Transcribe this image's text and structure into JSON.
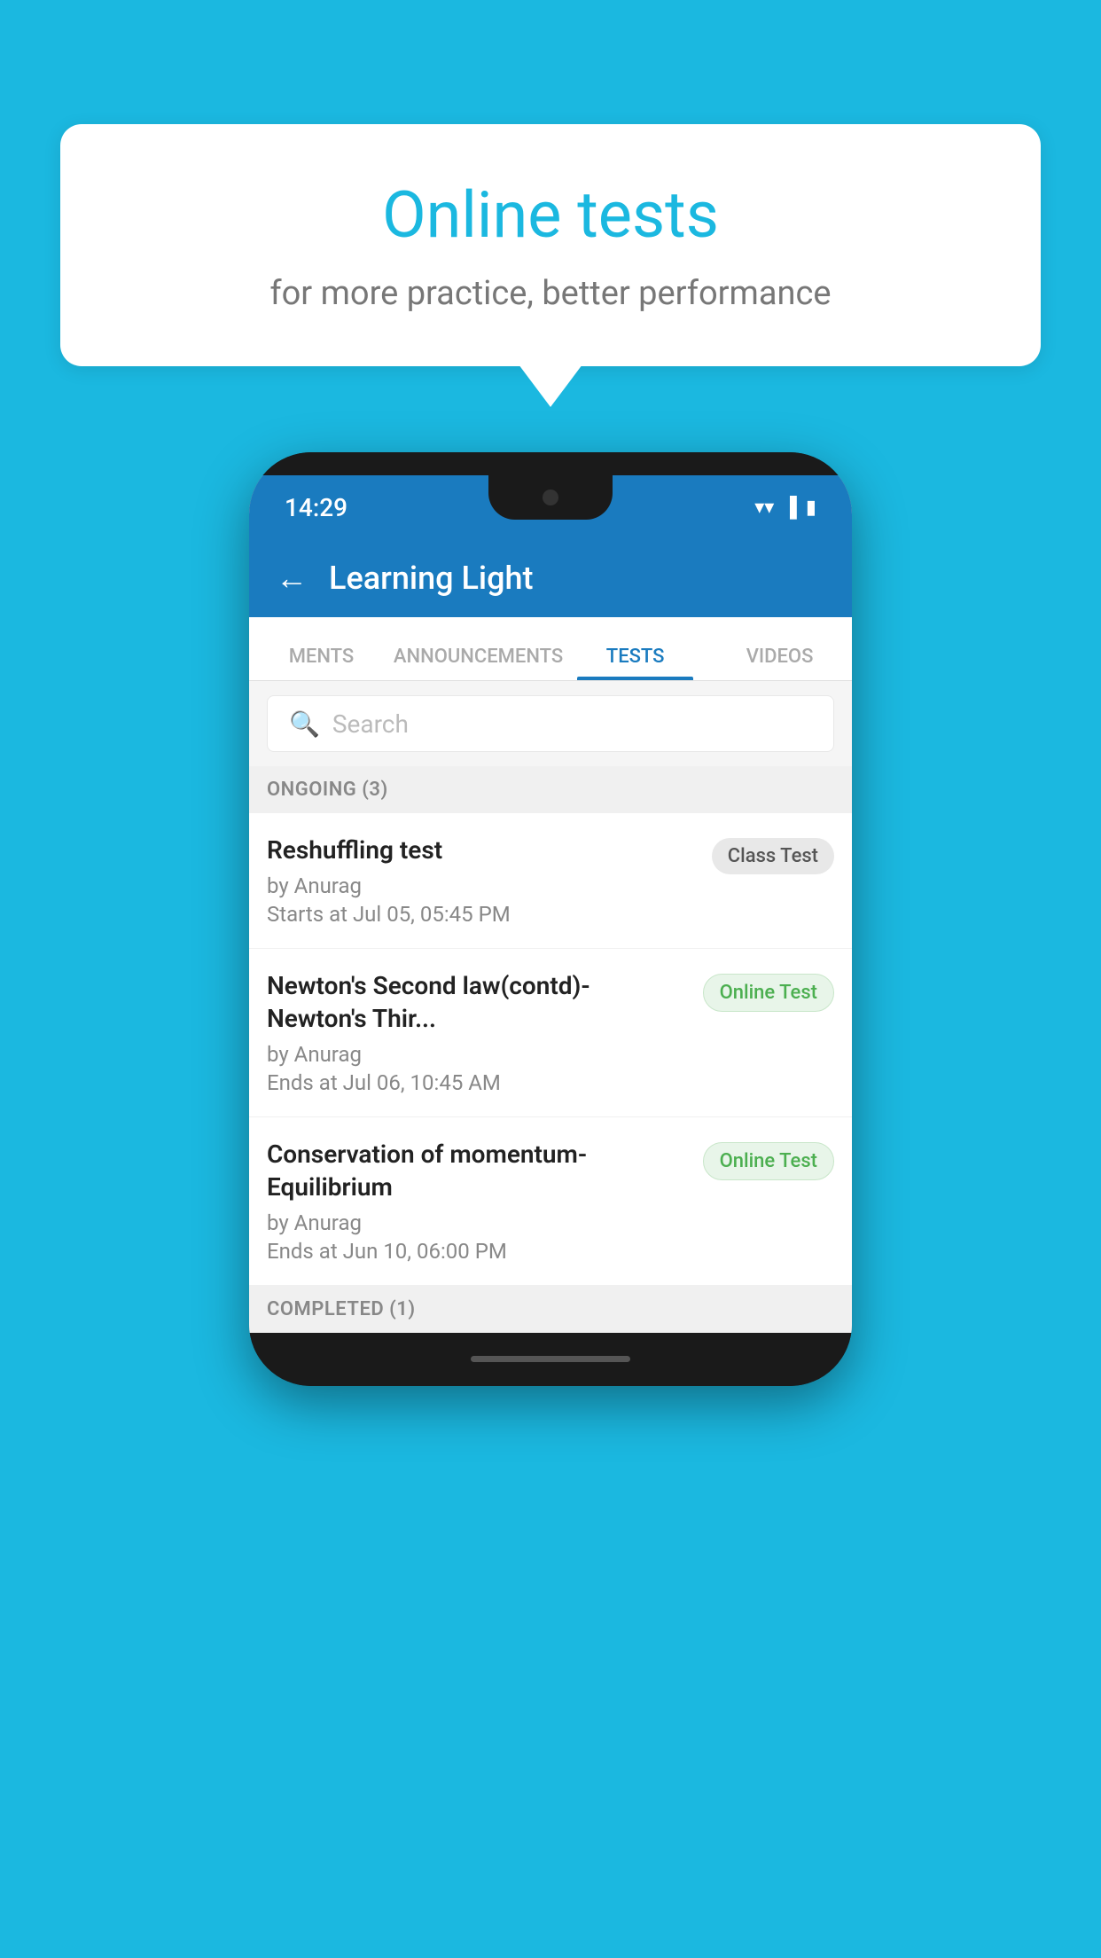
{
  "background_color": "#1bb8e0",
  "speech_bubble": {
    "title": "Online tests",
    "subtitle": "for more practice, better performance"
  },
  "phone": {
    "status_bar": {
      "time": "14:29",
      "icons": [
        "wifi",
        "signal",
        "battery"
      ]
    },
    "app_header": {
      "back_label": "←",
      "title": "Learning Light"
    },
    "tabs": [
      {
        "label": "MENTS",
        "active": false
      },
      {
        "label": "ANNOUNCEMENTS",
        "active": false
      },
      {
        "label": "TESTS",
        "active": true
      },
      {
        "label": "VIDEOS",
        "active": false
      }
    ],
    "search": {
      "placeholder": "Search"
    },
    "ongoing_section": {
      "label": "ONGOING (3)"
    },
    "tests": [
      {
        "name": "Reshuffling test",
        "author": "by Anurag",
        "time_label": "Starts at",
        "time": "Jul 05, 05:45 PM",
        "badge": "Class Test",
        "badge_type": "class"
      },
      {
        "name": "Newton's Second law(contd)-Newton's Thir...",
        "author": "by Anurag",
        "time_label": "Ends at",
        "time": "Jul 06, 10:45 AM",
        "badge": "Online Test",
        "badge_type": "online"
      },
      {
        "name": "Conservation of momentum-Equilibrium",
        "author": "by Anurag",
        "time_label": "Ends at",
        "time": "Jun 10, 06:00 PM",
        "badge": "Online Test",
        "badge_type": "online"
      }
    ],
    "completed_section": {
      "label": "COMPLETED (1)"
    }
  }
}
